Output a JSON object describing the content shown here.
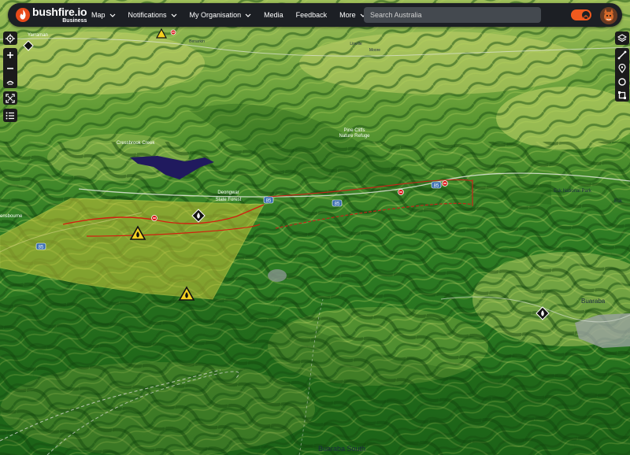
{
  "header": {
    "logo_name": "bushfire.io",
    "logo_sub": "Business",
    "nav": [
      {
        "label": "Map",
        "chevron": true
      },
      {
        "label": "Notifications",
        "chevron": true
      },
      {
        "label": "My Organisation",
        "chevron": true
      },
      {
        "label": "Media",
        "chevron": false
      },
      {
        "label": "Feedback",
        "chevron": false
      },
      {
        "label": "More",
        "chevron": true
      }
    ],
    "search_placeholder": "Search Australia",
    "toggle_on": true
  },
  "map": {
    "places": [
      {
        "id": "yarraman",
        "text": "Yarraman"
      },
      {
        "id": "cressbrook",
        "text": "Cressbrook Creek"
      },
      {
        "id": "pine_cliffs_1",
        "text": "Pine Cliffs"
      },
      {
        "id": "pine_cliffs_2",
        "text": "Nature Refuge"
      },
      {
        "id": "deongwar_1",
        "text": "Deongwar"
      },
      {
        "id": "deongwar_2",
        "text": "State Forest"
      },
      {
        "id": "esk_np",
        "text": "Esk National Park"
      },
      {
        "id": "esk",
        "text": "Esk"
      },
      {
        "id": "ensbourne",
        "text": "ensbourne"
      },
      {
        "id": "buaraba",
        "text": "Buaraba"
      },
      {
        "id": "buaraba_south",
        "text": "Buaraba South"
      },
      {
        "id": "moore",
        "text": "Moore"
      },
      {
        "id": "linville",
        "text": "Linville"
      },
      {
        "id": "benarkin",
        "text": "Benarkin"
      }
    ],
    "road_shields": [
      "85",
      "85",
      "85",
      "85"
    ]
  },
  "colors": {
    "accent": "#f05a1e",
    "fire_zone": "#c8c43a",
    "fire_line": "#d02010",
    "warning_icon": "#f5d020",
    "topbar": "#1c1f24"
  }
}
